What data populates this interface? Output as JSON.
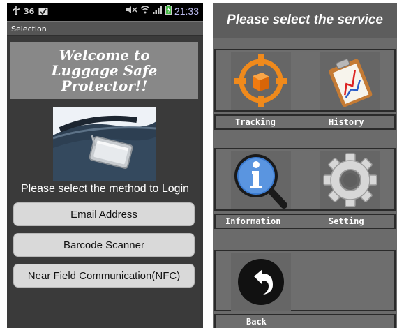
{
  "statusbar": {
    "left_badge": "36",
    "time": "21:33",
    "icons": [
      "usb-icon",
      "image-icon",
      "mute-icon",
      "wifi-icon",
      "signal-icon",
      "battery-icon"
    ]
  },
  "left_screen": {
    "title": "Selection",
    "welcome": "Welcome to\nLuggage Safe\nProtector!!",
    "login_prompt": "Please select the method to Login",
    "buttons": [
      "Email Address",
      "Barcode Scanner",
      "Near Field Communication(NFC)"
    ]
  },
  "right_screen": {
    "title": "Please select the service",
    "services": [
      {
        "label": "Tracking",
        "icon": "target-icon"
      },
      {
        "label": "History",
        "icon": "clipboard-chart-icon"
      },
      {
        "label": "Information",
        "icon": "info-magnifier-icon"
      },
      {
        "label": "Setting",
        "icon": "gear-icon"
      },
      {
        "label": "Back",
        "icon": "back-arrow-icon"
      }
    ]
  },
  "colors": {
    "screen_bg_left": "#3a3a3a",
    "screen_bg_right": "#6b6b6b",
    "target_orange": "#f08a1c",
    "info_blue": "#3b7bd0"
  }
}
